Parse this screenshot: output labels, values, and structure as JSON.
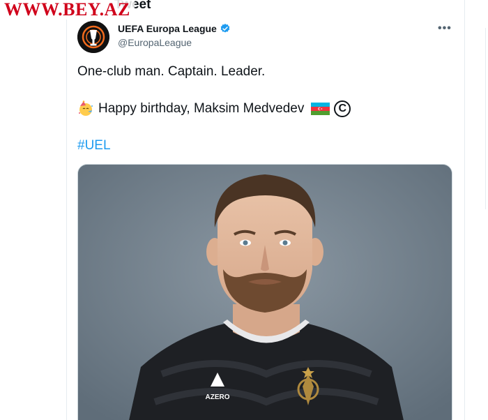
{
  "watermark": "WWW.BEY.AZ",
  "header": {
    "title": "Tweet"
  },
  "tweet": {
    "author": {
      "name": "UEFA Europa League",
      "handle": "@EuropaLeague",
      "verified": true
    },
    "text_line1": "One-club man. Captain. Leader.",
    "text_line2": "Happy birthday, Maksim Medvedev",
    "hashtag": "#UEL",
    "icons": [
      "party-face-icon",
      "azerbaijan-flag-icon",
      "copyright-icon",
      "verified-badge-icon",
      "more-options-icon"
    ],
    "media": {
      "jersey_brand": "AZERO"
    }
  },
  "colors": {
    "link": "#1d9bf0",
    "watermark": "#d0021b",
    "verified": "#1d9bf0",
    "photo_bg": "#72808c"
  }
}
